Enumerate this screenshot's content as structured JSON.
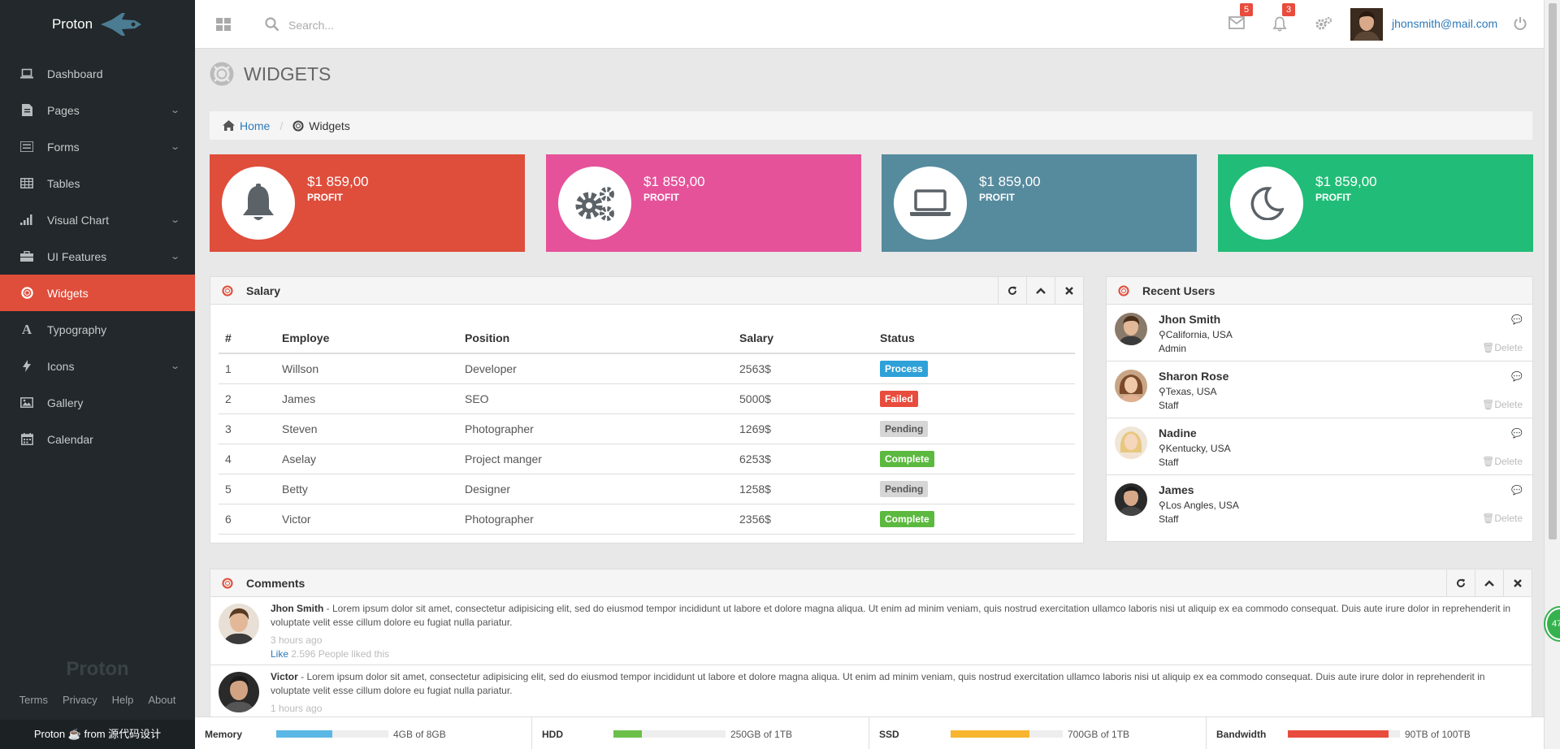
{
  "app": {
    "name": "Proton",
    "footer_brand": "Proton",
    "footer_text": "Proton ☕ from 源代码设计"
  },
  "sidebar": {
    "items": [
      {
        "label": "Dashboard",
        "icon": "laptop-icon",
        "has_children": false
      },
      {
        "label": "Pages",
        "icon": "file-icon",
        "has_children": true
      },
      {
        "label": "Forms",
        "icon": "list-icon",
        "has_children": true
      },
      {
        "label": "Tables",
        "icon": "table-icon",
        "has_children": false
      },
      {
        "label": "Visual Chart",
        "icon": "signal-icon",
        "has_children": true
      },
      {
        "label": "UI Features",
        "icon": "briefcase-icon",
        "has_children": true
      },
      {
        "label": "Widgets",
        "icon": "lifebuoy-icon",
        "has_children": false,
        "active": true
      },
      {
        "label": "Typography",
        "icon": "font-icon",
        "has_children": false
      },
      {
        "label": "Icons",
        "icon": "bolt-icon",
        "has_children": true
      },
      {
        "label": "Gallery",
        "icon": "image-icon",
        "has_children": false
      },
      {
        "label": "Calendar",
        "icon": "calendar-icon",
        "has_children": false
      }
    ],
    "links": [
      "Terms",
      "Privacy",
      "Help",
      "About"
    ]
  },
  "topbar": {
    "search_placeholder": "Search...",
    "messages_count": "5",
    "notifications_count": "3",
    "user_email": "jhonsmith@mail.com"
  },
  "page": {
    "title": "WIDGETS"
  },
  "breadcrumb": {
    "home": "Home",
    "current": "Widgets"
  },
  "stats": [
    {
      "value": "$1 859,00",
      "label": "PROFIT",
      "icon": "bell-icon",
      "color": "#df4d3b"
    },
    {
      "value": "$1 859,00",
      "label": "PROFIT",
      "icon": "gears-icon",
      "color": "#e5529a"
    },
    {
      "value": "$1 859,00",
      "label": "PROFIT",
      "icon": "laptop-icon",
      "color": "#568b9e"
    },
    {
      "value": "$1 859,00",
      "label": "PROFIT",
      "icon": "moon-icon",
      "color": "#21bd78"
    }
  ],
  "salary": {
    "title": "Salary",
    "headers": [
      "#",
      "Employe",
      "Position",
      "Salary",
      "Status"
    ],
    "rows": [
      {
        "n": "1",
        "name": "Willson",
        "position": "Developer",
        "salary": "2563$",
        "status": "Process",
        "status_color": "#2ea1d8"
      },
      {
        "n": "2",
        "name": "James",
        "position": "SEO",
        "salary": "5000$",
        "status": "Failed",
        "status_color": "#e84c3d"
      },
      {
        "n": "3",
        "name": "Steven",
        "position": "Photographer",
        "salary": "1269$",
        "status": "Pending",
        "status_color": "#d6d6d6"
      },
      {
        "n": "4",
        "name": "Aselay",
        "position": "Project manger",
        "salary": "6253$",
        "status": "Complete",
        "status_color": "#5cb93f"
      },
      {
        "n": "5",
        "name": "Betty",
        "position": "Designer",
        "salary": "1258$",
        "status": "Pending",
        "status_color": "#d6d6d6"
      },
      {
        "n": "6",
        "name": "Victor",
        "position": "Photographer",
        "salary": "2356$",
        "status": "Complete",
        "status_color": "#5cb93f"
      }
    ]
  },
  "recent_users": {
    "title": "Recent Users",
    "delete_label": "Delete",
    "users": [
      {
        "name": "Jhon Smith",
        "location": "California, USA",
        "role": "Admin"
      },
      {
        "name": "Sharon Rose",
        "location": "Texas, USA",
        "role": "Staff"
      },
      {
        "name": "Nadine",
        "location": "Kentucky, USA",
        "role": "Staff"
      },
      {
        "name": "James",
        "location": "Los Angles, USA",
        "role": "Staff"
      }
    ]
  },
  "comments": {
    "title": "Comments",
    "items": [
      {
        "author": "Jhon Smith",
        "text": " - Lorem ipsum dolor sit amet, consectetur adipisicing elit, sed do eiusmod tempor incididunt ut labore et dolore magna aliqua. Ut enim ad minim veniam, quis nostrud exercitation ullamco laboris nisi ut aliquip ex ea commodo consequat. Duis aute irure dolor in reprehenderit in voluptate velit esse cillum dolore eu fugiat nulla pariatur.",
        "time": "3 hours ago",
        "like_label": "Like",
        "likes": "2.596",
        "likes_text": "People liked this"
      },
      {
        "author": "Victor",
        "text": " - Lorem ipsum dolor sit amet, consectetur adipisicing elit, sed do eiusmod tempor incididunt ut labore et dolore magna aliqua. Ut enim ad minim veniam, quis nostrud exercitation ullamco laboris nisi ut aliquip ex ea commodo consequat. Duis aute irure dolor in reprehenderit in voluptate velit esse cillum dolore eu fugiat nulla pariatur.",
        "time": "1 hours ago"
      }
    ]
  },
  "resources": [
    {
      "label": "Memory",
      "text": "4GB of 8GB",
      "fraction": 0.5,
      "color": "#5bb7e5"
    },
    {
      "label": "HDD",
      "text": "250GB of 1TB",
      "fraction": 0.25,
      "color": "#6cc04a"
    },
    {
      "label": "SSD",
      "text": "700GB of 1TB",
      "fraction": 0.7,
      "color": "#f7b530"
    },
    {
      "label": "Bandwidth",
      "text": "90TB of 100TB",
      "fraction": 0.9,
      "color": "#e84c3d"
    }
  ],
  "float_badge": "47"
}
